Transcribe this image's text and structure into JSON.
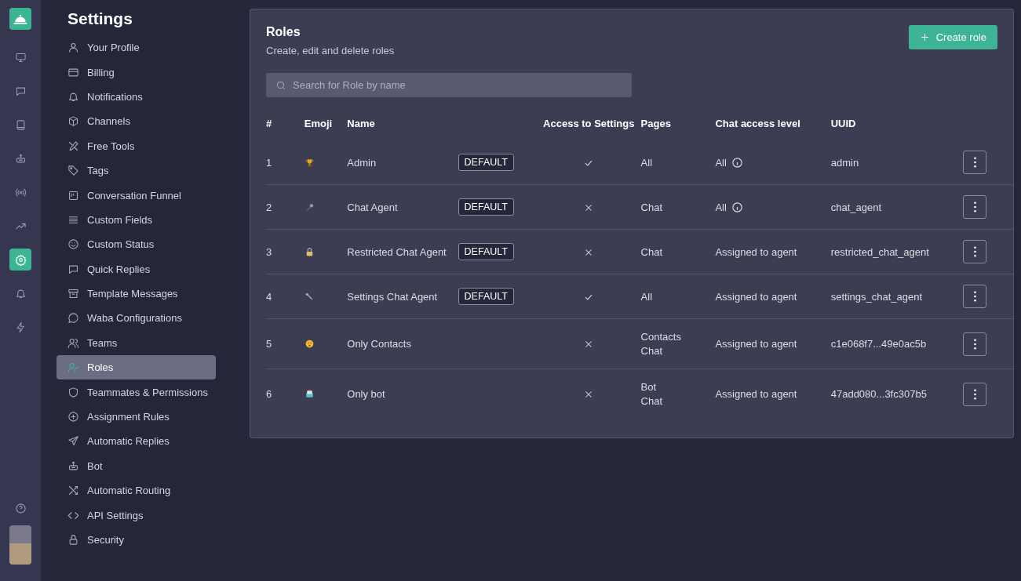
{
  "rail": {
    "items": [
      {
        "selected": false
      },
      {
        "selected": false
      },
      {
        "selected": false
      },
      {
        "selected": false
      },
      {
        "selected": false
      },
      {
        "selected": false
      },
      {
        "selected": true
      },
      {
        "selected": false
      },
      {
        "selected": false
      }
    ]
  },
  "sidebar": {
    "title": "Settings",
    "items": [
      {
        "label": "Your Profile",
        "selected": false
      },
      {
        "label": "Billing",
        "selected": false
      },
      {
        "label": "Notifications",
        "selected": false
      },
      {
        "label": "Channels",
        "selected": false
      },
      {
        "label": "Free Tools",
        "selected": false
      },
      {
        "label": "Tags",
        "selected": false
      },
      {
        "label": "Conversation Funnel",
        "selected": false
      },
      {
        "label": "Custom Fields",
        "selected": false
      },
      {
        "label": "Custom Status",
        "selected": false
      },
      {
        "label": "Quick Replies",
        "selected": false
      },
      {
        "label": "Template Messages",
        "selected": false
      },
      {
        "label": "Waba Configurations",
        "selected": false
      },
      {
        "label": "Teams",
        "selected": false
      },
      {
        "label": "Roles",
        "selected": true
      },
      {
        "label": "Teammates & Permissions",
        "selected": false
      },
      {
        "label": "Assignment Rules",
        "selected": false
      },
      {
        "label": "Automatic Replies",
        "selected": false
      },
      {
        "label": "Bot",
        "selected": false
      },
      {
        "label": "Automatic Routing",
        "selected": false
      },
      {
        "label": "API Settings",
        "selected": false
      },
      {
        "label": "Security",
        "selected": false
      }
    ]
  },
  "page": {
    "title": "Roles",
    "subtitle": "Create, edit and delete roles",
    "create_button": "Create role",
    "search": {
      "placeholder": "Search for Role by name"
    }
  },
  "table": {
    "columns": [
      "#",
      "Emoji",
      "Name",
      "Access to Settings",
      "Pages",
      "Chat access level",
      "UUID"
    ],
    "rows": [
      {
        "number": "1",
        "name": "Admin",
        "badge": "DEFAULT",
        "access": true,
        "pages": [
          "All"
        ],
        "chat_access": "All",
        "info": true,
        "uuid": "admin"
      },
      {
        "number": "2",
        "name": "Chat Agent",
        "badge": "DEFAULT",
        "access": false,
        "pages": [
          "Chat"
        ],
        "chat_access": "All",
        "info": true,
        "uuid": "chat_agent"
      },
      {
        "number": "3",
        "name": "Restricted Chat Agent",
        "badge": "DEFAULT",
        "access": false,
        "pages": [
          "Chat"
        ],
        "chat_access": "Assigned to agent",
        "info": false,
        "uuid": "restricted_chat_agent"
      },
      {
        "number": "4",
        "name": "Settings Chat Agent",
        "badge": "DEFAULT",
        "access": true,
        "pages": [
          "All"
        ],
        "chat_access": "Assigned to agent",
        "info": false,
        "uuid": "settings_chat_agent"
      },
      {
        "number": "5",
        "name": "Only Contacts",
        "access": false,
        "pages": [
          "Contacts",
          "Chat"
        ],
        "chat_access": "Assigned to agent",
        "info": false,
        "uuid": "c1e068f7...49e0ac5b"
      },
      {
        "number": "6",
        "name": "Only bot",
        "access": false,
        "pages": [
          "Bot",
          "Chat"
        ],
        "chat_access": "Assigned to agent",
        "info": false,
        "uuid": "47add080...3fc307b5"
      }
    ]
  }
}
